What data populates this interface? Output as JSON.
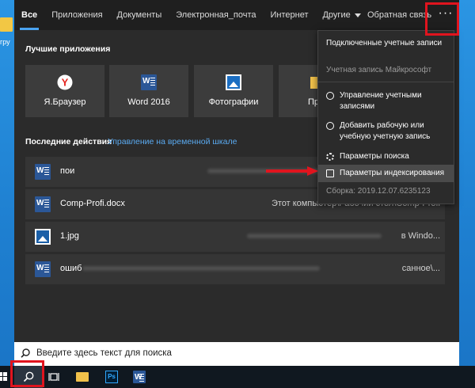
{
  "desktop": {
    "icon_label": "гру"
  },
  "nav": {
    "tabs": [
      {
        "label": "Все",
        "active": true
      },
      {
        "label": "Приложения"
      },
      {
        "label": "Документы"
      },
      {
        "label": "Электронная_почта"
      },
      {
        "label": "Интернет"
      },
      {
        "label": "Другие"
      }
    ],
    "feedback": "Обратная связь",
    "ellipsis": "···"
  },
  "best_apps": {
    "title": "Лучшие приложения",
    "tiles": [
      {
        "label": "Я.Браузер",
        "icon": "yandex-browser-icon"
      },
      {
        "label": "Word 2016",
        "icon": "word-icon"
      },
      {
        "label": "Фотографии",
        "icon": "photos-icon"
      },
      {
        "label": "Пров",
        "icon": "explorer-icon"
      }
    ]
  },
  "recent": {
    "title": "Последние действия",
    "timeline_link": "Управление на временной шкале",
    "items": [
      {
        "name": "пои",
        "path": "",
        "icon": "word-icon"
      },
      {
        "name": "Comp-Profi.docx",
        "path": "Этот компьютер\\Рабочий стол\\Comp-Profi",
        "icon": "word-icon"
      },
      {
        "name": "1.jpg",
        "path": "в Windo...",
        "icon": "image-icon"
      },
      {
        "name": "ошиб",
        "path": "санное\\...",
        "icon": "word-icon"
      }
    ]
  },
  "dropdown": {
    "header": "Подключенные учетные записи",
    "account": "Учетная запись Майкрософт",
    "items": [
      {
        "label": "Управление учетными записями",
        "icon": "user-icon"
      },
      {
        "label": "Добавить рабочую или учебную учетную запись",
        "icon": "user-add-icon"
      },
      {
        "label": "Параметры поиска",
        "icon": "gear-icon"
      },
      {
        "label": "Параметры индексирования",
        "icon": "indexing-icon"
      }
    ],
    "build": "Сборка: 2019.12.07.6235123"
  },
  "search": {
    "placeholder": "Введите здесь текст для поиска"
  },
  "taskbar": {
    "ps_label": "Ps"
  },
  "colors": {
    "accent": "#4aa3f0",
    "annotation": "#e0141e",
    "panel": "#2b2b2b"
  }
}
